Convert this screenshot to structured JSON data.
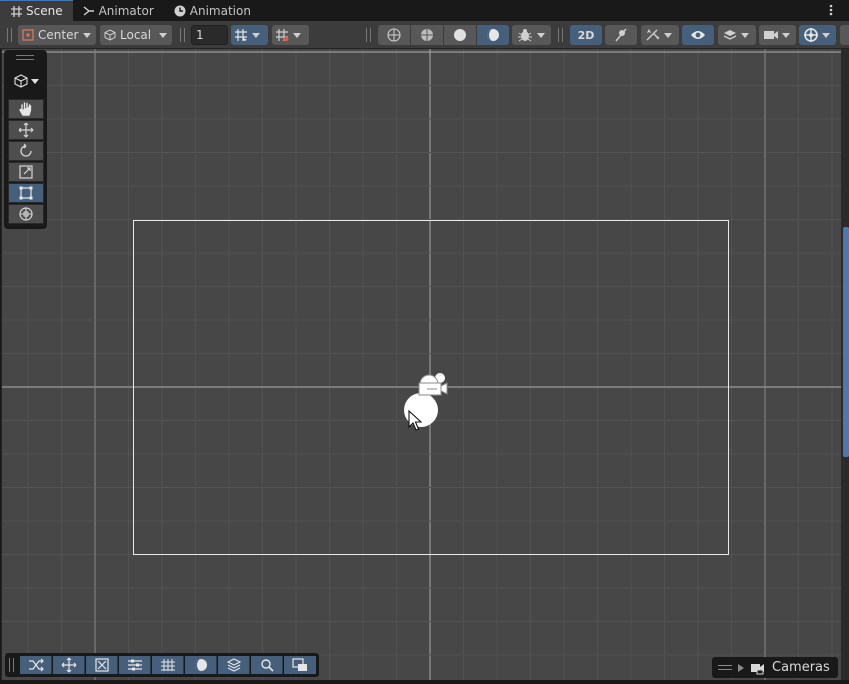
{
  "tabs": [
    {
      "label": "Scene",
      "icon": "grid-icon",
      "active": true
    },
    {
      "label": "Animator",
      "icon": "animator-icon",
      "active": false
    },
    {
      "label": "Animation",
      "icon": "clock-icon",
      "active": false
    }
  ],
  "toolbar": {
    "pivot_mode": "Center",
    "pivot_rotation": "Local",
    "grid_snap_value": "1",
    "mode_2d_label": "2D"
  },
  "overlays": {
    "cameras_label": "Cameras"
  },
  "colors": {
    "accent": "#46607c",
    "scene_bg": "#474747",
    "panel": "#191919",
    "scroll_thumb": "#4b78ad"
  }
}
